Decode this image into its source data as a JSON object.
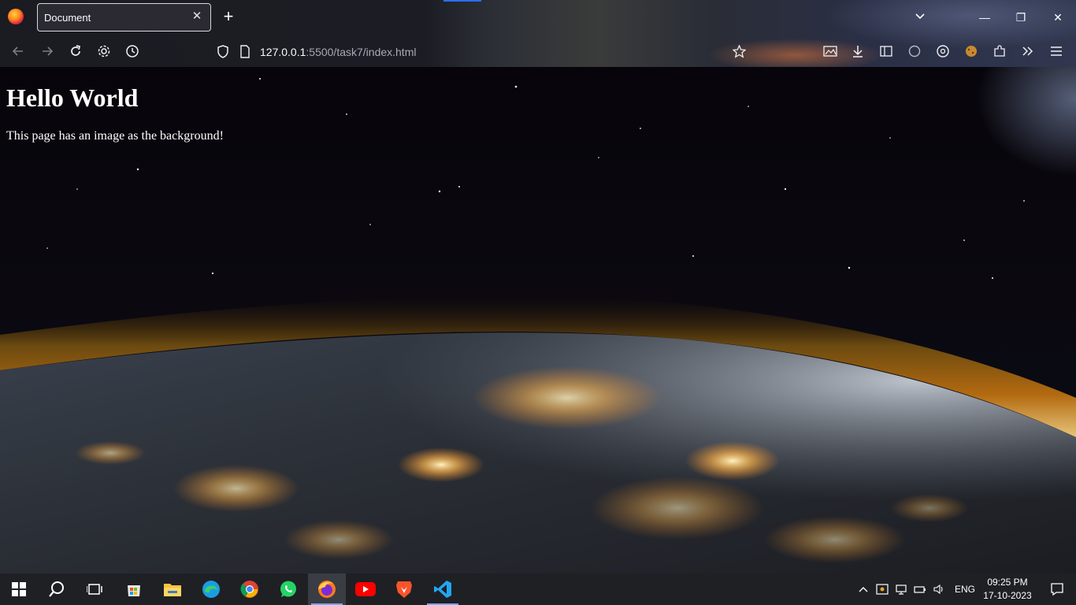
{
  "browser": {
    "tab_title": "Document",
    "new_tab_symbol": "+",
    "close_tab_symbol": "✕",
    "url_host": "127.0.0.1",
    "url_rest": ":5500/task7/index.html",
    "window_controls": {
      "minimize": "—",
      "maximize": "❐",
      "close": "✕"
    }
  },
  "page": {
    "heading": "Hello World",
    "paragraph": "This page has an image as the background!"
  },
  "taskbar": {
    "apps": [
      "start",
      "search",
      "task-view",
      "microsoft-store",
      "file-explorer",
      "edge",
      "chrome",
      "whatsapp",
      "firefox",
      "youtube",
      "brave",
      "vscode"
    ],
    "language": "ENG",
    "time": "09:25 PM",
    "date": "17-10-2023"
  },
  "colors": {
    "chrome_bg": "#1c1b22",
    "tab_border": "#d7d7db",
    "taskbar_bg": "#1f2024",
    "page_text": "#ffffff"
  }
}
